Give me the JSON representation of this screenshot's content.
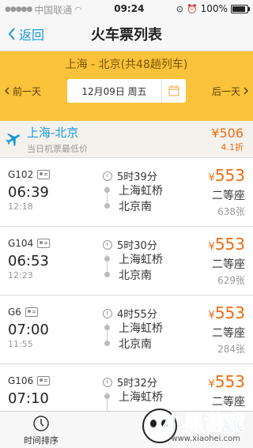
{
  "status_bar": {
    "carrier": "中国联通",
    "time": "09:24",
    "battery": "100%"
  },
  "nav": {
    "back_label": "返回",
    "title": "火车票列表"
  },
  "route": {
    "summary": "上海 - 北京(共48趟列车)",
    "prev_day": "前一天",
    "date": "12月09日  周五",
    "next_day": "后一天"
  },
  "flight": {
    "title": "上海-北京",
    "subtitle": "当日机票最低价",
    "price": "¥506",
    "discount": "4.1折"
  },
  "trains": [
    {
      "no": "G102",
      "dep": "06:39",
      "arr": "12:18",
      "duration": "5时39分",
      "from": "上海虹桥",
      "to": "北京南",
      "price": "553",
      "seat": "二等座",
      "left": "638张"
    },
    {
      "no": "G104",
      "dep": "06:53",
      "arr": "12:23",
      "duration": "5时30分",
      "from": "上海虹桥",
      "to": "北京南",
      "price": "553",
      "seat": "二等座",
      "left": "629张"
    },
    {
      "no": "G6",
      "dep": "07:00",
      "arr": "11:55",
      "duration": "4时55分",
      "from": "上海虹桥",
      "to": "北京南",
      "price": "553",
      "seat": "二等座",
      "left": "284张"
    },
    {
      "no": "G106",
      "dep": "07:10",
      "arr": "",
      "duration": "5时32分",
      "from": "上海虹桥",
      "to": "",
      "price": "553",
      "seat": "二等座",
      "left": ""
    }
  ],
  "currency": "¥",
  "bottom": {
    "sort_label": "时间排序"
  },
  "watermark": {
    "brand": "小黑游戏",
    "url": "www.xiaohei.com"
  },
  "colors": {
    "accent": "#1a9bd7",
    "price": "#ee6b0f",
    "banner": "#fbc33b"
  }
}
